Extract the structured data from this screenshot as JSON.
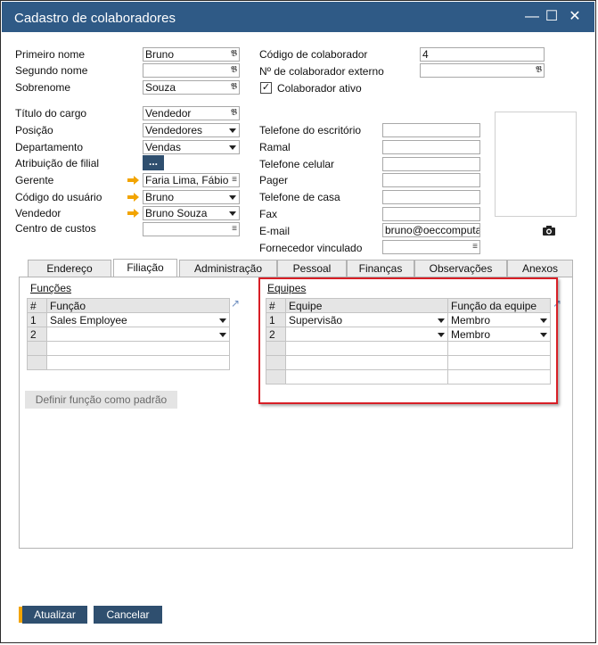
{
  "window": {
    "title": "Cadastro de colaboradores",
    "minimize_icon": "minimize-icon",
    "maximize_icon": "maximize-icon",
    "close_icon": "close-icon"
  },
  "fields": {
    "primeiro_nome": {
      "label": "Primeiro nome",
      "value": "Bruno"
    },
    "segundo_nome": {
      "label": "Segundo nome",
      "value": ""
    },
    "sobrenome": {
      "label": "Sobrenome",
      "value": "Souza"
    },
    "titulo_cargo": {
      "label": "Título do cargo",
      "value": "Vendedor"
    },
    "posicao": {
      "label": "Posição",
      "value": "Vendedores"
    },
    "departamento": {
      "label": "Departamento",
      "value": "Vendas"
    },
    "atribuicao_filial": {
      "label": "Atribuição de filial",
      "button": "..."
    },
    "gerente": {
      "label": "Gerente",
      "value": "Faria Lima, Fábio"
    },
    "codigo_usuario": {
      "label": "Código do usuário",
      "value": "Bruno"
    },
    "vendedor": {
      "label": "Vendedor",
      "value": "Bruno Souza"
    },
    "centro_custos": {
      "label": "Centro de custos",
      "value": ""
    },
    "codigo_colaborador": {
      "label": "Código de colaborador",
      "value": "4"
    },
    "num_colab_externo": {
      "label": "Nº de colaborador externo",
      "value": ""
    },
    "colaborador_ativo": {
      "label": "Colaborador ativo",
      "checked": true
    },
    "tel_escritorio": {
      "label": "Telefone do escritório",
      "value": ""
    },
    "ramal": {
      "label": "Ramal",
      "value": ""
    },
    "tel_celular": {
      "label": "Telefone celular",
      "value": ""
    },
    "pager": {
      "label": "Pager",
      "value": ""
    },
    "tel_casa": {
      "label": "Telefone de casa",
      "value": ""
    },
    "fax": {
      "label": "Fax",
      "value": ""
    },
    "email": {
      "label": "E-mail",
      "value": "bruno@oeccomputa"
    },
    "fornecedor_vinculado": {
      "label": "Fornecedor vinculado",
      "value": ""
    }
  },
  "tabs": [
    "Endereço",
    "Filiação",
    "Administração",
    "Pessoal",
    "Finanças",
    "Observações",
    "Anexos"
  ],
  "active_tab": "Filiação",
  "funcoes": {
    "title": "Funções",
    "headers": [
      "#",
      "Função"
    ],
    "rows": [
      [
        "1",
        "Sales Employee"
      ],
      [
        "2",
        ""
      ],
      [
        "",
        ""
      ],
      [
        "",
        ""
      ]
    ],
    "default_button": "Definir função como padrão"
  },
  "equipes": {
    "title": "Equipes",
    "headers": [
      "#",
      "Equipe",
      "Função da equipe"
    ],
    "rows": [
      [
        "1",
        "Supervisão",
        "Membro"
      ],
      [
        "2",
        "",
        "Membro"
      ],
      [
        "",
        "",
        ""
      ],
      [
        "",
        "",
        ""
      ],
      [
        "",
        "",
        ""
      ]
    ]
  },
  "footer": {
    "update": "Atualizar",
    "cancel": "Cancelar"
  },
  "colors": {
    "titlebar": "#2f5a86",
    "footer_button": "#2f4f6f",
    "highlight": "#d81f26",
    "link_arrow": "#f2a400"
  }
}
